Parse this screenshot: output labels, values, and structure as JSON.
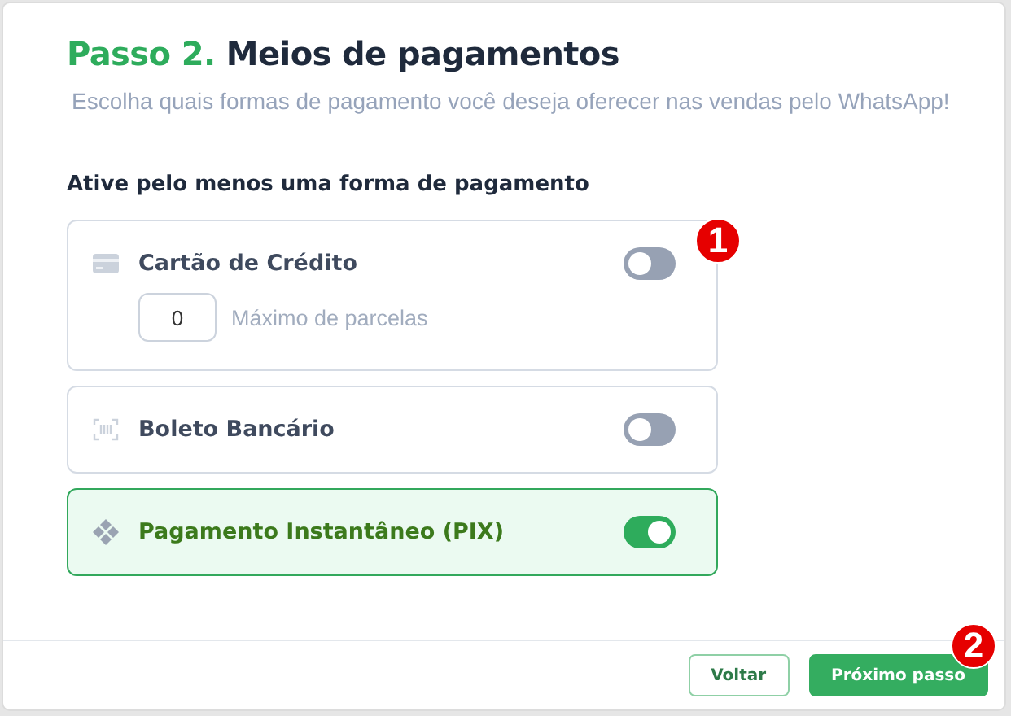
{
  "header": {
    "step": "Passo 2.",
    "title": "Meios de pagamentos",
    "subtitle": "Escolha quais formas de pagamento você deseja oferecer nas vendas pelo WhatsApp!"
  },
  "section_title": "Ative pelo menos uma forma de pagamento",
  "methods": [
    {
      "kind": "card",
      "label": "Cartão de Crédito",
      "on": false,
      "installments": {
        "value": "0",
        "label": "Máximo de parcelas"
      }
    },
    {
      "kind": "barcode",
      "label": "Boleto Bancário",
      "on": false
    },
    {
      "kind": "pix",
      "label": "Pagamento Instantâneo (PIX)",
      "on": true
    }
  ],
  "buttons": [
    {
      "kind": "secondary",
      "label": "Voltar"
    },
    {
      "kind": "primary",
      "label": "Próximo passo"
    }
  ],
  "markers": [
    "1",
    "2"
  ]
}
